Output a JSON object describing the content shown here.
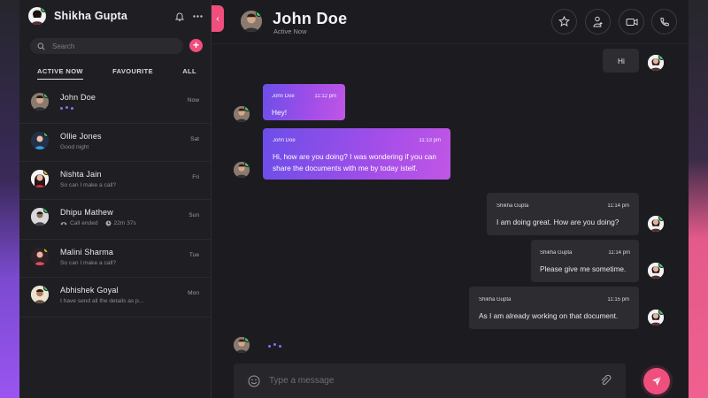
{
  "user": {
    "name": "Shikha Gupta"
  },
  "sidebar": {
    "search_placeholder": "Search",
    "tabs": [
      "ACTIVE NOW",
      "FAVOURITE",
      "ALL"
    ],
    "contacts": [
      {
        "name": "John Doe",
        "message": "",
        "time": "Now",
        "status": "online",
        "typing": true
      },
      {
        "name": "Ollie Jones",
        "message": "Good night",
        "time": "Sat",
        "status": "online"
      },
      {
        "name": "Nishta Jain",
        "message": "So can I make a call?",
        "time": "Fri",
        "status": "away"
      },
      {
        "name": "Dhipu Mathew",
        "message": "Call ended",
        "duration": "22m 37s",
        "time": "Sun",
        "status": "online"
      },
      {
        "name": "Malini Sharma",
        "message": "So can I make a call?",
        "time": "Tue",
        "status": "away"
      },
      {
        "name": "Abhishek Goyal",
        "message": "I have send all the details as p...",
        "time": "Mon",
        "status": "online"
      }
    ]
  },
  "chat": {
    "title": "John Doe",
    "status": "Active Now",
    "header_icons": [
      "star-icon",
      "add-user-icon",
      "video-icon",
      "phone-icon"
    ],
    "messages": [
      {
        "direction": "out",
        "sender": "",
        "time": "",
        "text": "Hi"
      },
      {
        "direction": "in",
        "sender": "John Doe",
        "time": "11:12 pm",
        "text": "Hey!"
      },
      {
        "direction": "in",
        "sender": "John Doe",
        "time": "11:13 pm",
        "text": "Hi, how are you doing? I was wondering if you can share the documents with me by today istelf."
      },
      {
        "direction": "out",
        "sender": "Shikha Gupta",
        "time": "11:14 pm",
        "text": "I am doing great. How are you doing?"
      },
      {
        "direction": "out",
        "sender": "Shikha Gupta",
        "time": "11:14 pm",
        "text": "Please give me sometime."
      },
      {
        "direction": "out",
        "sender": "Shikha Gupta",
        "time": "11:15 pm",
        "text": "As I am already working on that document."
      }
    ],
    "composer_placeholder": "Type a message"
  },
  "colors": {
    "accent": "#ee4f7d",
    "bubble_gradient_start": "#6c4ee8",
    "bubble_gradient_end": "#c056e6",
    "online": "#3ad65b",
    "away": "#f0c419"
  }
}
